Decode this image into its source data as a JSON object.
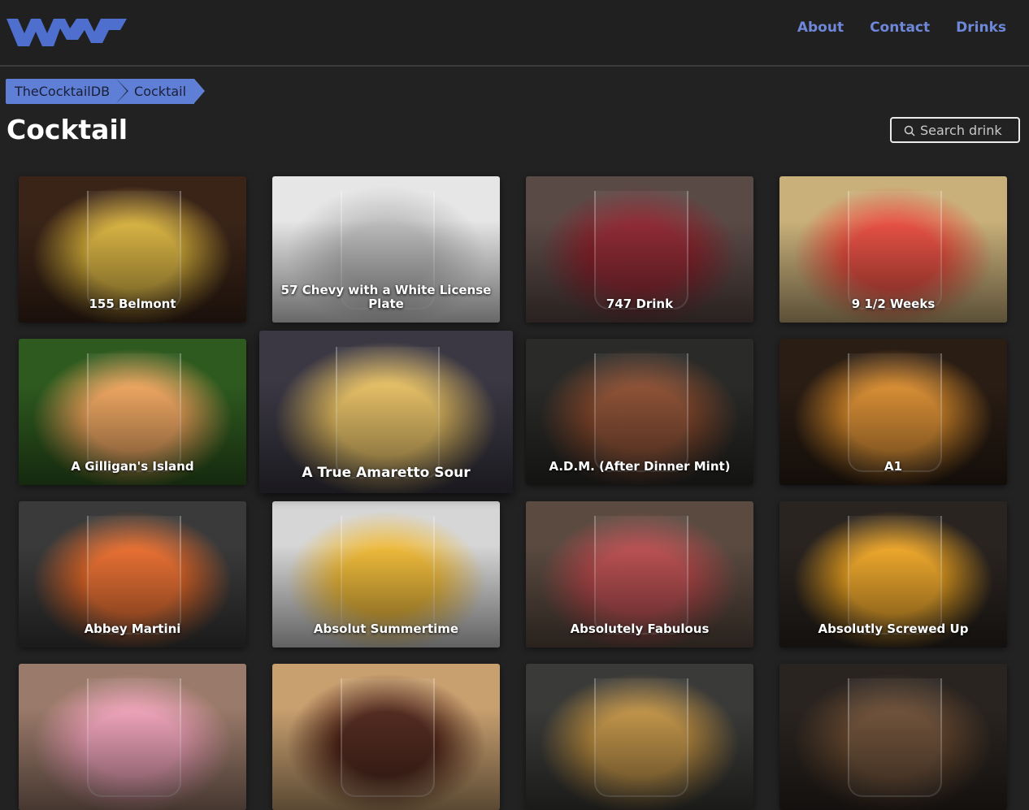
{
  "header": {
    "logo": "logo-icon",
    "nav": [
      {
        "label": "About"
      },
      {
        "label": "Contact"
      },
      {
        "label": "Drinks"
      }
    ]
  },
  "breadcrumb": [
    {
      "label": "TheCocktailDB"
    },
    {
      "label": "Cocktail"
    }
  ],
  "page_title": "Cocktail",
  "search": {
    "placeholder": "Search drink",
    "icon": "search-icon"
  },
  "drinks": [
    {
      "name": "155 Belmont",
      "colors": [
        "#3a2418",
        "#d9b23a"
      ]
    },
    {
      "name": "57 Chevy with a White License Plate",
      "colors": [
        "#e6e6e6",
        "#b9b9b9"
      ]
    },
    {
      "name": "747 Drink",
      "colors": [
        "#5a4a46",
        "#8b1f2a"
      ]
    },
    {
      "name": "9 1/2 Weeks",
      "colors": [
        "#c9b07a",
        "#e8483a"
      ]
    },
    {
      "name": "A Gilligan's Island",
      "colors": [
        "#2e5a1f",
        "#f0a35a"
      ]
    },
    {
      "name": "A True Amaretto Sour",
      "colors": [
        "#3b3844",
        "#e8c060"
      ]
    },
    {
      "name": "A.D.M. (After Dinner Mint)",
      "colors": [
        "#2a2a28",
        "#8a4a2c"
      ]
    },
    {
      "name": "A1",
      "colors": [
        "#2a1d14",
        "#d98a2a"
      ]
    },
    {
      "name": "Abbey Martini",
      "colors": [
        "#3a3a3a",
        "#ea6a28"
      ]
    },
    {
      "name": "Absolut Summertime",
      "colors": [
        "#d6d6d6",
        "#f0b830"
      ]
    },
    {
      "name": "Absolutely Fabulous",
      "colors": [
        "#5a4a40",
        "#b8484a"
      ]
    },
    {
      "name": "Absolutly Screwed Up",
      "colors": [
        "#2a2420",
        "#f0a520"
      ]
    },
    {
      "name": "",
      "colors": [
        "#9a7a6a",
        "#f0a0b8"
      ]
    },
    {
      "name": "",
      "colors": [
        "#c8a070",
        "#4a1f14"
      ]
    },
    {
      "name": "",
      "colors": [
        "#3a3a38",
        "#c09040"
      ]
    },
    {
      "name": "",
      "colors": [
        "#2a2420",
        "#6a4a30"
      ]
    }
  ]
}
